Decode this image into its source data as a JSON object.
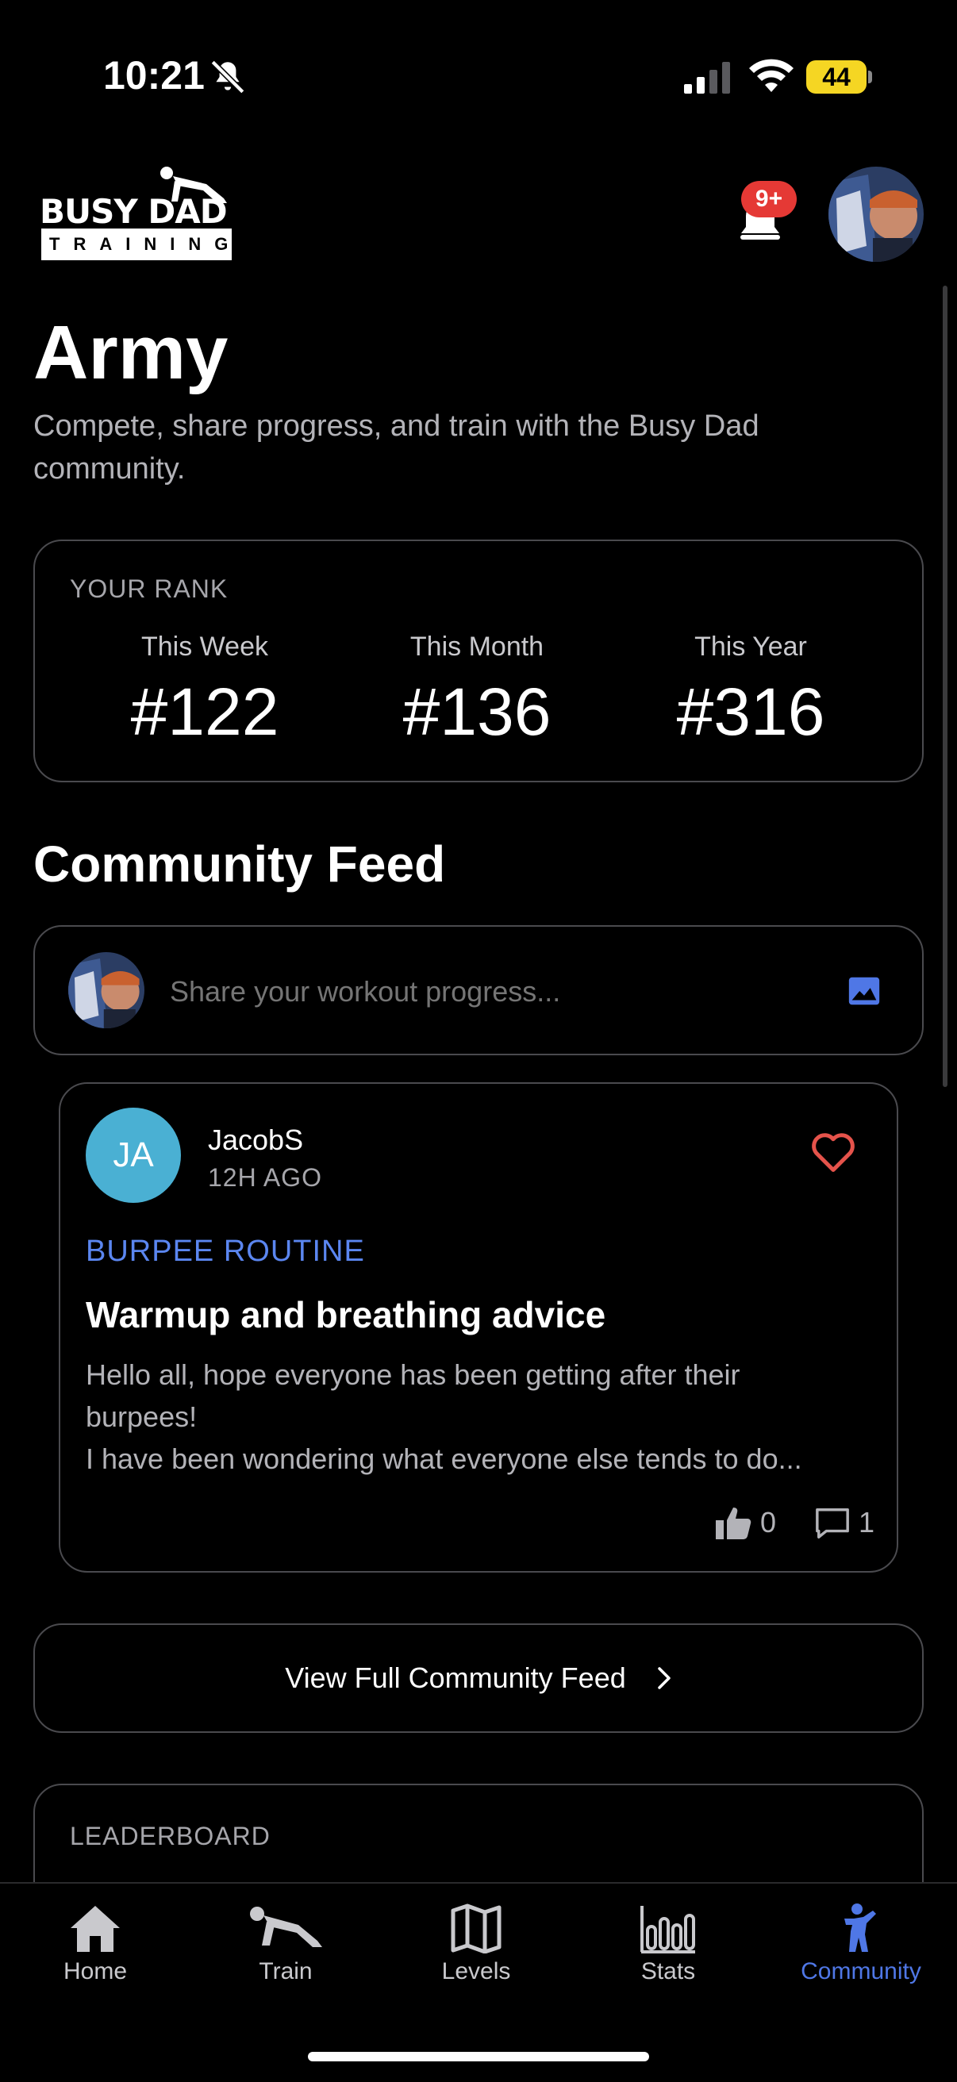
{
  "status_bar": {
    "time": "10:21",
    "battery": "44"
  },
  "header": {
    "logo_top": "BUSY DAD",
    "logo_bottom": "TRAINING",
    "notification_badge": "9+"
  },
  "page": {
    "title": "Army",
    "subtitle": "Compete, share progress, and train with the Busy Dad community."
  },
  "rank": {
    "label": "YOUR RANK",
    "columns": [
      {
        "label": "This Week",
        "value": "#122"
      },
      {
        "label": "This Month",
        "value": "#136"
      },
      {
        "label": "This Year",
        "value": "#316"
      }
    ]
  },
  "feed": {
    "title": "Community Feed",
    "composer_placeholder": "Share your workout progress...",
    "post": {
      "initials": "JA",
      "user": "JacobS",
      "time": "12H AGO",
      "category": "BURPEE ROUTINE",
      "title": "Warmup and breathing advice",
      "body_line1": "Hello all, hope everyone has been getting after their",
      "body_line2": "burpees!",
      "body_line3": "I have been wondering what everyone else tends to do...",
      "likes": "0",
      "comments": "1"
    },
    "view_full_label": "View Full Community Feed"
  },
  "leaderboard": {
    "label": "LEADERBOARD"
  },
  "tabs": [
    {
      "label": "Home",
      "icon": "home-icon"
    },
    {
      "label": "Train",
      "icon": "pushup-icon"
    },
    {
      "label": "Levels",
      "icon": "map-icon"
    },
    {
      "label": "Stats",
      "icon": "bar-chart-icon"
    },
    {
      "label": "Community",
      "icon": "person-icon"
    }
  ],
  "colors": {
    "accent": "#4f77e6",
    "category": "#5b86f0",
    "badge": "#e53935",
    "heart": "#e5534b",
    "avatar_bg": "#4ab0d3",
    "battery": "#f5d623"
  }
}
